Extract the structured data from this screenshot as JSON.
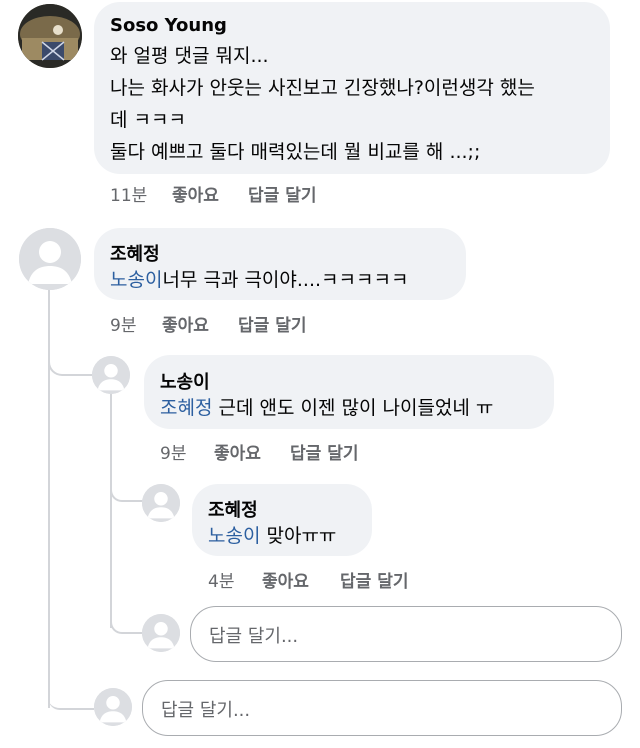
{
  "comments": {
    "c1": {
      "author": "Soso Young",
      "lines": [
        "와 얼평 댓글 뭐지...",
        "나는 화사가 안웃는 사진보고 긴장했나?이런생각 했는",
        "데 ㅋㅋㅋ",
        "둘다 예쁘고 둘다 매력있는데 뭘 비교를 해 ...;;"
      ],
      "time": "11분",
      "like": "좋아요",
      "reply": "답글 달기"
    },
    "c2": {
      "author": "조혜정",
      "mention": "노송이",
      "text": "너무 극과 극이야....ㅋㅋㅋㅋㅋ",
      "time": "9분",
      "like": "좋아요",
      "reply": "답글 달기"
    },
    "c3": {
      "author": "노송이",
      "mention": "조혜정",
      "text": " 근데 앤도 이젠 많이 나이들었네 ㅠ",
      "time": "9분",
      "like": "좋아요",
      "reply": "답글 달기"
    },
    "c4": {
      "author": "조혜정",
      "mention": "노송이",
      "text": " 맞아ㅠㅠ",
      "time": "4분",
      "like": "좋아요",
      "reply": "답글 달기"
    }
  },
  "reply_boxes": {
    "nested_placeholder": "답글 달기...",
    "main_placeholder": "답글 달기..."
  },
  "icons": {
    "default_avatar": "person-silhouette-icon"
  },
  "colors": {
    "bubble": "#f0f2f5",
    "mention": "#2c5fa0",
    "meta": "#65676b",
    "thread_line": "#d3d5d9"
  }
}
